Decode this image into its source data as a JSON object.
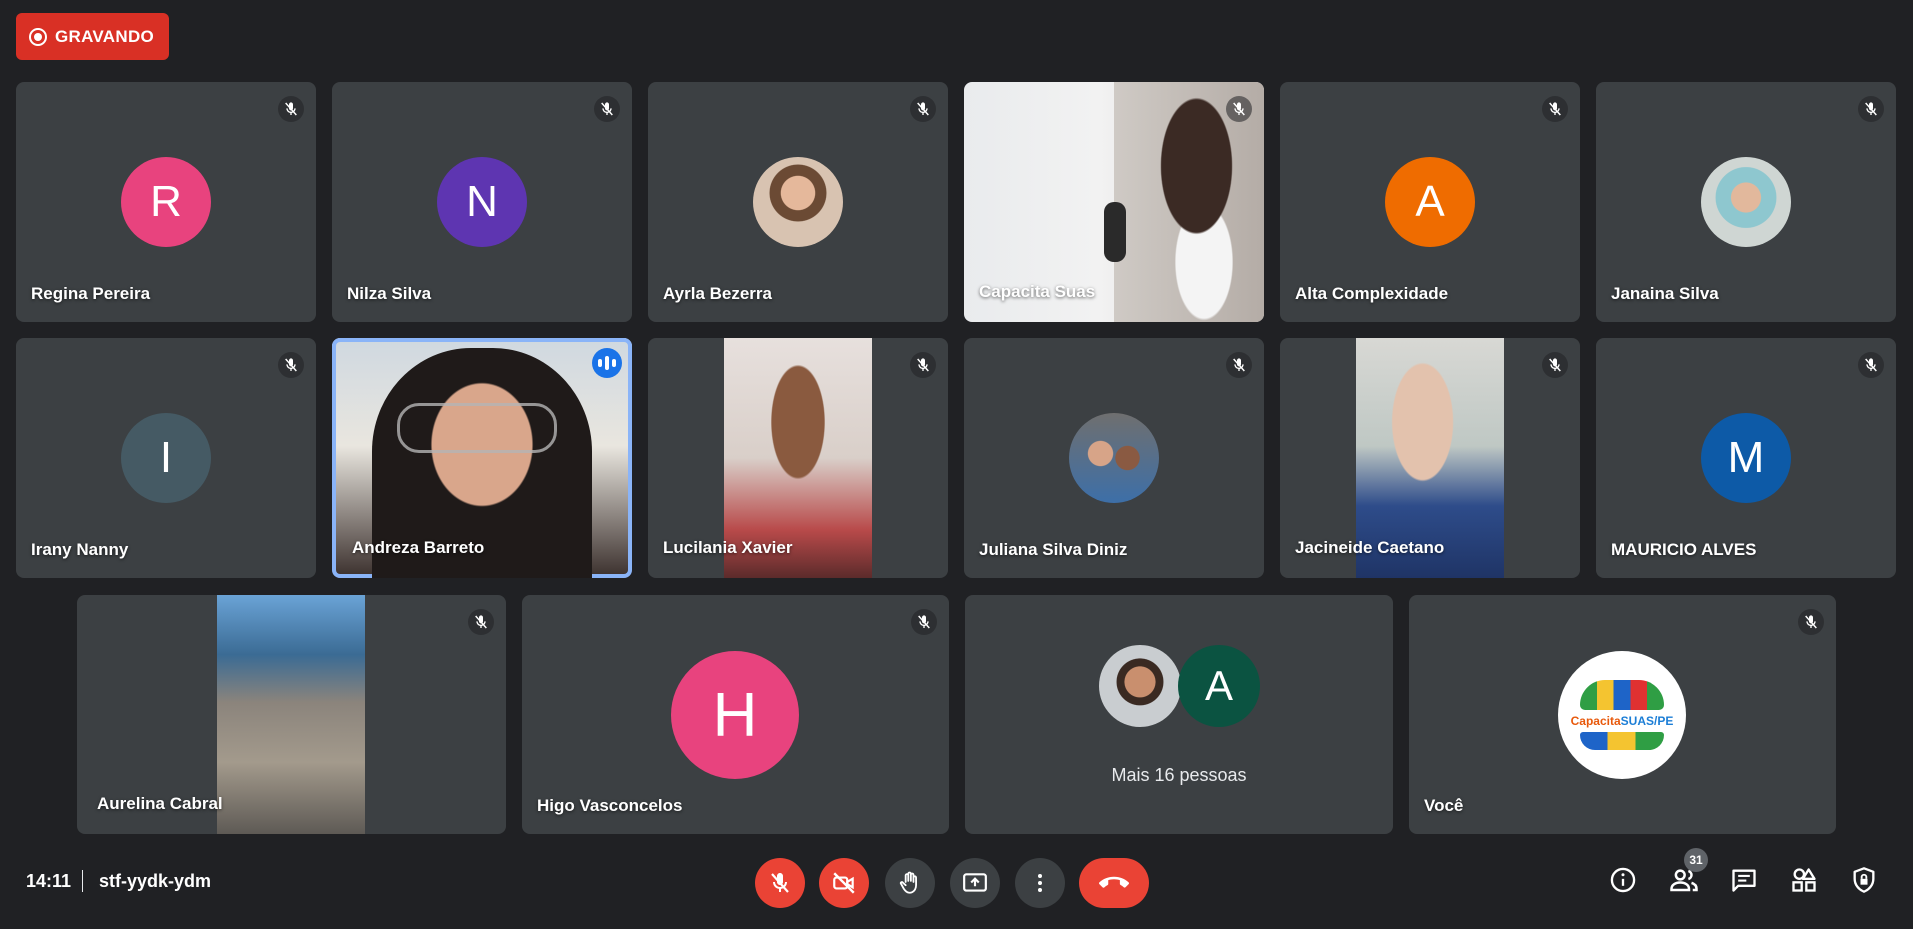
{
  "recording": {
    "label": "GRAVANDO",
    "color": "#d93025"
  },
  "participants": {
    "regina": {
      "name": "Regina Pereira",
      "initial": "R",
      "color": "#e8437e"
    },
    "nilza": {
      "name": "Nilza Silva",
      "initial": "N",
      "color": "#5e35b1"
    },
    "ayrla": {
      "name": "Ayrla Bezerra"
    },
    "capacita": {
      "name": "Capacita Suas"
    },
    "alta": {
      "name": "Alta Complexidade",
      "initial": "A",
      "color": "#ef6c00"
    },
    "janaina": {
      "name": "Janaina Silva"
    },
    "irany": {
      "name": "Irany Nanny",
      "initial": "I",
      "color": "#455a64"
    },
    "andreza": {
      "name": "Andreza Barreto"
    },
    "lucilania": {
      "name": "Lucilania Xavier"
    },
    "juliana": {
      "name": "Juliana Silva Diniz"
    },
    "jacineide": {
      "name": "Jacineide Caetano"
    },
    "mauricio": {
      "name": "MAURICIO ALVES",
      "initial": "M",
      "color": "#0d5aa7"
    },
    "aurelina": {
      "name": "Aurelina Cabral"
    },
    "higo": {
      "name": "Higo Vasconcelos",
      "initial": "H",
      "color": "#e8437e"
    },
    "more": {
      "label": "Mais 16 pessoas",
      "initial": "A",
      "color": "#0b5341"
    },
    "you": {
      "name": "Você",
      "logo_text_1": "Capacita",
      "logo_text_2": "SUAS/PE"
    }
  },
  "meeting": {
    "time": "14:11",
    "code": "stf-yydk-ydm"
  },
  "people_count": "31",
  "icons": {
    "mic_off": "mic-off-icon",
    "cam_off": "videocam-off-icon",
    "raise_hand": "hand-icon",
    "present": "present-screen-icon",
    "more": "more-vert-icon",
    "hangup": "call-end-icon",
    "info": "info-icon",
    "people": "people-icon",
    "chat": "chat-icon",
    "activities": "activities-icon",
    "host_controls": "shield-lock-icon"
  }
}
